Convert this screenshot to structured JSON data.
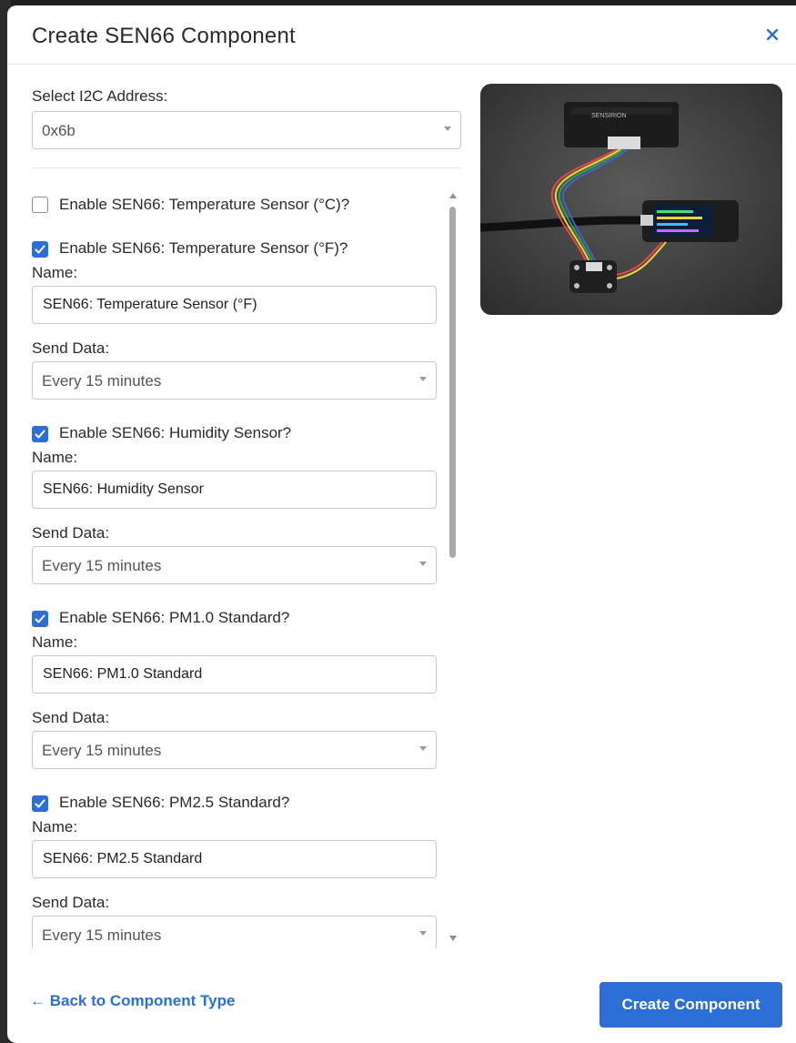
{
  "modal": {
    "title": "Create SEN66 Component",
    "close_icon": "close-icon"
  },
  "i2c": {
    "label": "Select I2C Address:",
    "value": "0x6b"
  },
  "sensors": [
    {
      "checkbox_label": "Enable SEN66: Temperature Sensor (°C)?",
      "checked": false
    },
    {
      "checkbox_label": "Enable SEN66: Temperature Sensor (°F)?",
      "checked": true,
      "name_label": "Name:",
      "name_value": "SEN66: Temperature Sensor (°F)",
      "send_label": "Send Data:",
      "send_value": "Every 15 minutes"
    },
    {
      "checkbox_label": "Enable SEN66: Humidity Sensor?",
      "checked": true,
      "name_label": "Name:",
      "name_value": "SEN66: Humidity Sensor",
      "send_label": "Send Data:",
      "send_value": "Every 15 minutes"
    },
    {
      "checkbox_label": "Enable SEN66: PM1.0 Standard?",
      "checked": true,
      "name_label": "Name:",
      "name_value": "SEN66: PM1.0 Standard",
      "send_label": "Send Data:",
      "send_value": "Every 15 minutes"
    },
    {
      "checkbox_label": "Enable SEN66: PM2.5 Standard?",
      "checked": true,
      "name_label": "Name:",
      "name_value": "SEN66: PM2.5 Standard",
      "send_label": "Send Data:",
      "send_value": "Every 15 minutes"
    }
  ],
  "image": {
    "brand_text": "SENSIRION"
  },
  "footer": {
    "back_label": "← Back to Component Type",
    "create_label": "Create Component"
  },
  "colors": {
    "accent": "#2b6fd6",
    "text": "#2b2b2b"
  }
}
